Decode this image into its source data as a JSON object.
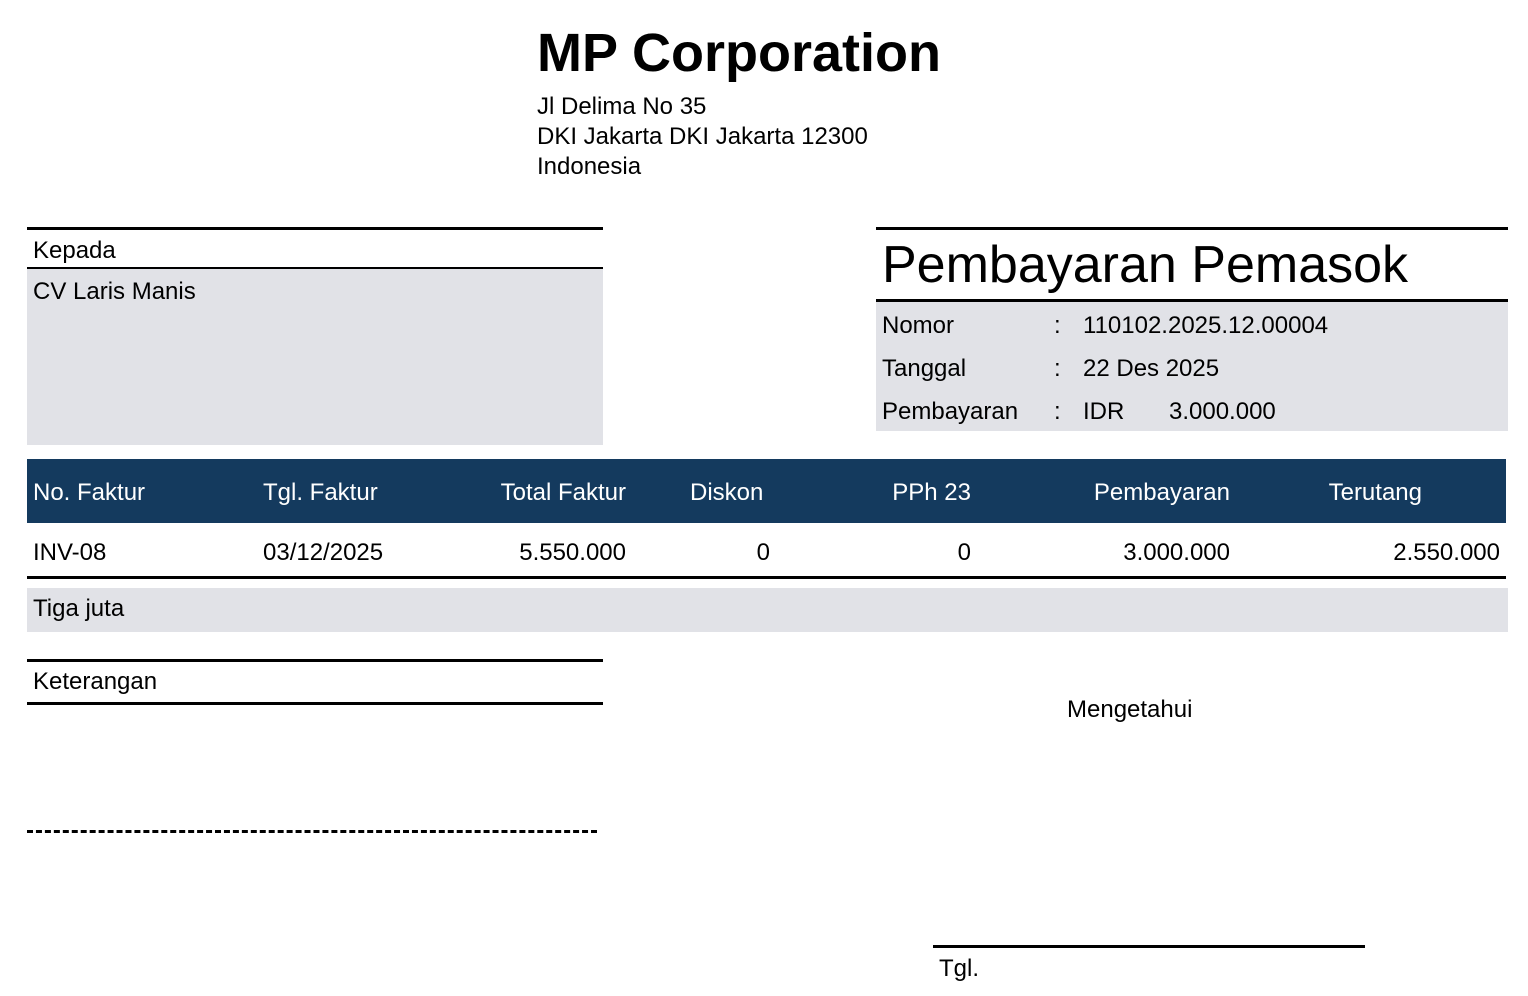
{
  "company": {
    "name": "MP Corporation",
    "address_line1": "Jl Delima No 35",
    "address_line2": "DKI Jakarta DKI Jakarta 12300",
    "address_line3": "Indonesia"
  },
  "recipient": {
    "label": "Kepada",
    "name": "CV Laris Manis"
  },
  "document": {
    "title": "Pembayaran Pemasok",
    "fields": [
      {
        "label": "Nomor",
        "colon": ":",
        "value": "110102.2025.12.00004",
        "value2": ""
      },
      {
        "label": "Tanggal",
        "colon": ":",
        "value": "22 Des 2025",
        "value2": ""
      },
      {
        "label": "Pembayaran",
        "colon": ":",
        "value": "IDR",
        "value2": "3.000.000"
      }
    ]
  },
  "table": {
    "headers": [
      "No. Faktur",
      "Tgl. Faktur",
      "Total Faktur",
      "Diskon",
      "PPh 23",
      "Pembayaran",
      "Terutang"
    ],
    "rows": [
      [
        "INV-08",
        "03/12/2025",
        "5.550.000",
        "0",
        "0",
        "3.000.000",
        "2.550.000"
      ]
    ],
    "header_color": "#143a5e"
  },
  "amount_in_words": "Tiga juta",
  "notes": {
    "label": "Keterangan"
  },
  "signature": {
    "acknowledged_label": "Mengetahui",
    "date_label": "Tgl."
  },
  "colors": {
    "panel_gray": "#e1e2e7",
    "header_navy": "#143a5e"
  }
}
